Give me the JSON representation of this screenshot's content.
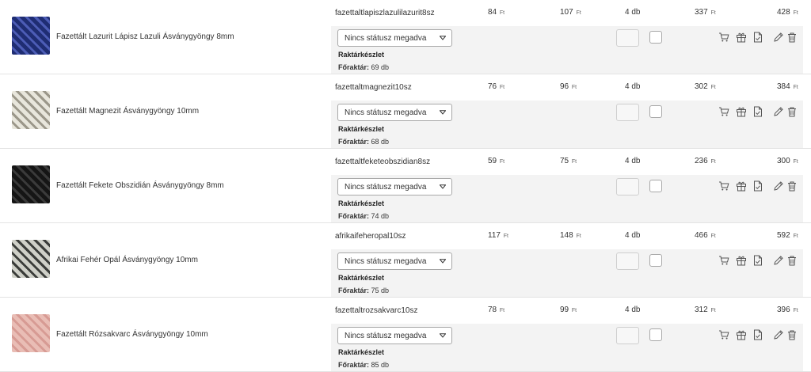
{
  "products": [
    {
      "name": "Fazettált Lazurit Lápisz Lazuli Ásványgyöngy 8mm",
      "sku": "fazettaltlapiszlazulilazurit8sz",
      "price1": "84",
      "price2": "107",
      "qty": "4 db",
      "total1": "337",
      "total2": "428",
      "status": "Nincs státusz megadva",
      "stock_label": "Raktárkészlet",
      "stock_location": "Főraktár:",
      "stock_value": "69 db",
      "thumb_color": "#1f2d73",
      "thumb_accent": "#4c5cb5"
    },
    {
      "name": "Fazettált Magnezit Ásványgyöngy 10mm",
      "sku": "fazettaltmagnezit10sz",
      "price1": "76",
      "price2": "96",
      "qty": "4 db",
      "total1": "302",
      "total2": "384",
      "status": "Nincs státusz megadva",
      "stock_label": "Raktárkészlet",
      "stock_location": "Főraktár:",
      "stock_value": "68 db",
      "thumb_color": "#e8e6dc",
      "thumb_accent": "#9b978a"
    },
    {
      "name": "Fazettált Fekete Obszidián Ásványgyöngy 8mm",
      "sku": "fazettaltfeketeobszidian8sz",
      "price1": "59",
      "price2": "75",
      "qty": "4 db",
      "total1": "236",
      "total2": "300",
      "status": "Nincs státusz megadva",
      "stock_label": "Raktárkészlet",
      "stock_location": "Főraktár:",
      "stock_value": "74 db",
      "thumb_color": "#151515",
      "thumb_accent": "#3a3a3a"
    },
    {
      "name": "Afrikai Fehér Opál Ásványgyöngy 10mm",
      "sku": "afrikaifeheropal10sz",
      "price1": "117",
      "price2": "148",
      "qty": "4 db",
      "total1": "466",
      "total2": "592",
      "status": "Nincs státusz megadva",
      "stock_label": "Raktárkészlet",
      "stock_location": "Főraktár:",
      "stock_value": "75 db",
      "thumb_color": "#cfd0c8",
      "thumb_accent": "#3b3d3a"
    },
    {
      "name": "Fazettált Rózsakvarc Ásványgyöngy 10mm",
      "sku": "fazettaltrozsakvarc10sz",
      "price1": "78",
      "price2": "99",
      "qty": "4 db",
      "total1": "312",
      "total2": "396",
      "status": "Nincs státusz megadva",
      "stock_label": "Raktárkészlet",
      "stock_location": "Főraktár:",
      "stock_value": "85 db",
      "thumb_color": "#e9bdb5",
      "thumb_accent": "#d79b94"
    }
  ],
  "currency": "Ft",
  "colors": {
    "border": "#e3e3e3",
    "grey_panel": "#f3f3f3",
    "icon": "#555555"
  },
  "icons": [
    "cart-icon",
    "gift-box-icon",
    "document-check-icon",
    "pencil-icon",
    "trash-icon"
  ]
}
